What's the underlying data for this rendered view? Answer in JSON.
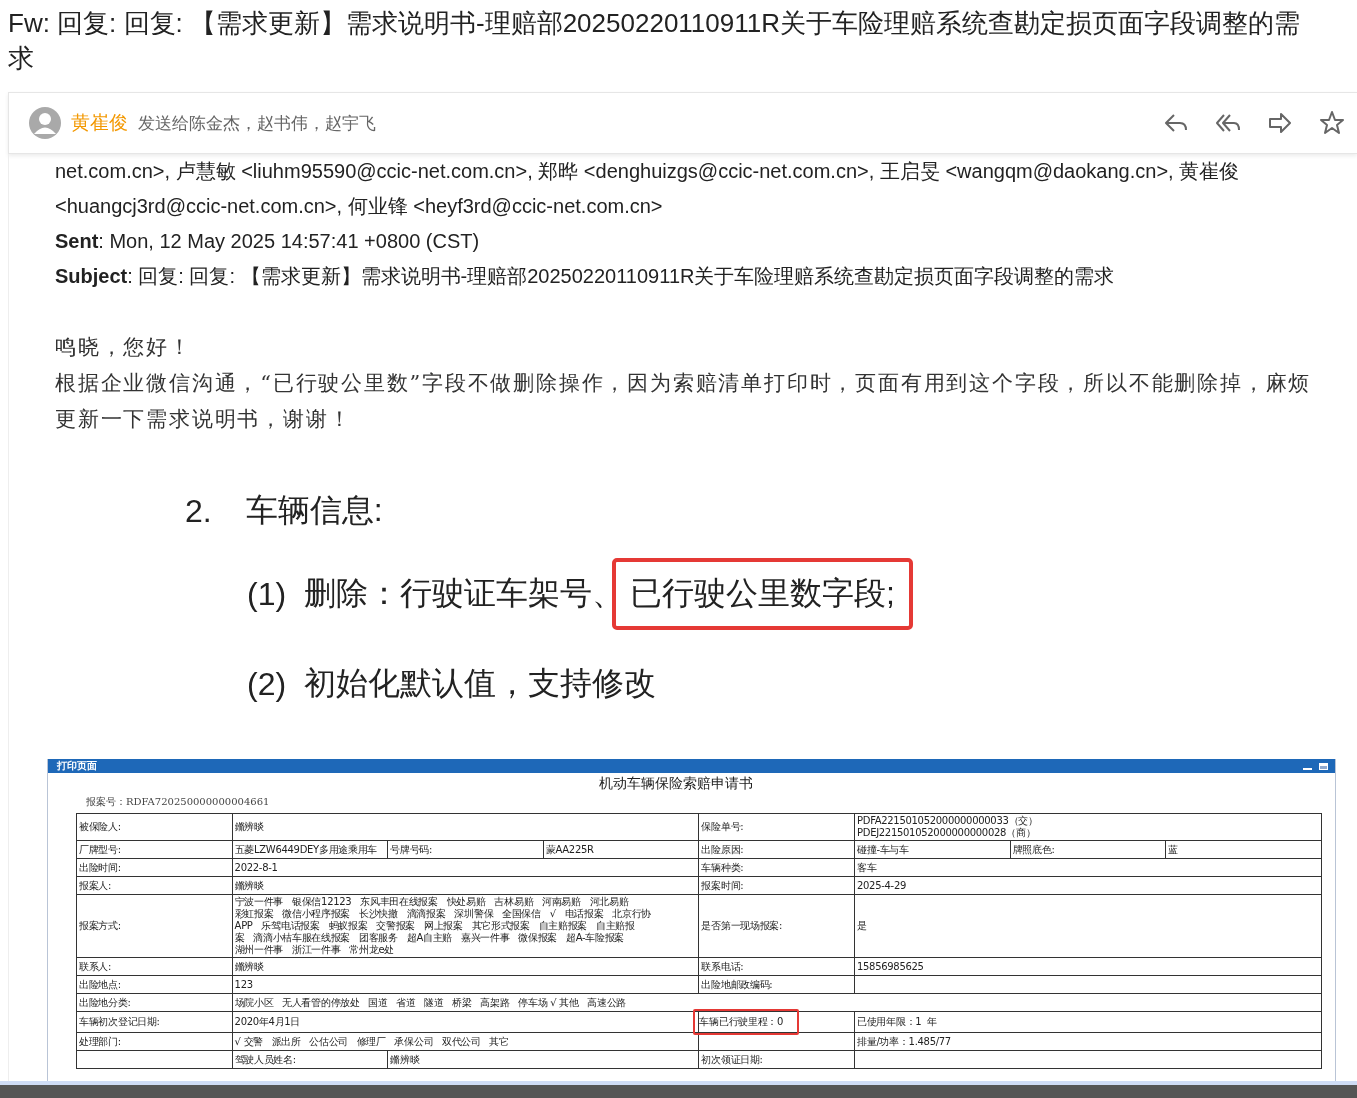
{
  "title": "Fw: 回复: 回复: 【需求更新】需求说明书-理赔部20250220110911R关于车险理赔系统查勘定损页面字段调整的需求",
  "sender": {
    "name": "黄崔俊",
    "recipients": "发送给陈金杰，赵书伟，赵宇飞"
  },
  "headers": [
    "net.com.cn>, 卢慧敏 <liuhm95590@ccic-net.com.cn>, 郑晔 <denghuizgs@ccic-net.com.cn>, 王启旻 <wangqm@daokang.cn>, 黄崔俊",
    "<huangcj3rd@ccic-net.com.cn>, 何业锋 <heyf3rd@ccic-net.com.cn>",
    "**Sent**: Mon, 12 May 2025 14:57:41 +0800 (CST)",
    "**Subject**: 回复: 回复: 【需求更新】需求说明书-理赔部20250220110911R关于车险理赔系统查勘定损页面字段调整的需求"
  ],
  "body": [
    "鸣晓，您好！",
    "根据企业微信沟通，“已行驶公里数”字段不做删除操作，因为索赔清单打印时，页面有用到这个字段，所以不能删除掉，麻烦更新一下需求说明书，谢谢！"
  ],
  "spec": {
    "number": "2.",
    "heading": "车辆信息:",
    "items": [
      {
        "number": "(1)",
        "text": "删除：行驶证车架号、",
        "highlight_text": "已行驶公里数字段;"
      },
      {
        "number": "(2)",
        "text": "初始化默认值，支持修改"
      }
    ]
  },
  "print_page": {
    "window_title": "打印页面",
    "doc_title": "机动车辆保险索赔申请书",
    "report_no": "报案号：RDFA720250000000004661",
    "rows": [
      [
        {
          "text": "被保险人:",
          "highlighted": false
        },
        {
          "text": "鏅辨晱",
          "colspan": 3,
          "highlighted": false
        },
        {
          "text": "保险单号:",
          "highlighted": false
        },
        {
          "lines": [
            "PDFA221501052000000000033（交）",
            "PDEJ221501052000000000028（商）"
          ],
          "colspan": 3,
          "highlighted": false
        }
      ],
      [
        {
          "text": "厂牌型号:",
          "highlighted": false
        },
        {
          "text": "五菱LZW6449DEY多用途乘用车",
          "highlighted": false
        },
        {
          "text": "号牌号码:",
          "highlighted": false
        },
        {
          "text": "蒙AA225R",
          "highlighted": false
        },
        {
          "text": "出险原因:",
          "highlighted": false
        },
        {
          "text": "碰撞-车与车",
          "highlighted": false
        },
        {
          "text": "牌照底色:",
          "highlighted": false
        },
        {
          "text": "蓝",
          "highlighted": false
        }
      ],
      [
        {
          "text": "出险时间:",
          "highlighted": false
        },
        {
          "text": "2022-8-1",
          "colspan": 3,
          "highlighted": false
        },
        {
          "text": "车辆种类:",
          "highlighted": false
        },
        {
          "text": "客车",
          "colspan": 3,
          "highlighted": false
        }
      ],
      [
        {
          "text": "报案人:",
          "highlighted": false
        },
        {
          "text": "鏅辨晱",
          "colspan": 3,
          "highlighted": false
        },
        {
          "text": "报案时间:",
          "highlighted": false
        },
        {
          "text": "2025-4-29",
          "colspan": 3,
          "highlighted": false
        }
      ],
      [
        {
          "text": "报案方式:",
          "highlighted": false
        },
        {
          "lines": [
            "宁波一件事   银保信12123   东风丰田在线报案   快处易赔   吉林易赔   河南易赔   河北易赔",
            "彩虹报案   微信小程序报案   长沙快撤   滴滴报案   深圳警保   全国保信 √ 电话报案   北京行协",
            "APP   乐驾电话报案   蚂蚁报案   交警报案   网上报案   其它形式报案   自主赔报案   自主赔报",
            "案   滴滴小桔车服在线报案   团客服务   超A自主赔   嘉兴一件事   微保报案   超A-车险报案",
            "湖州一件事   浙江一件事   常州龙e处"
          ],
          "colspan": 3,
          "highlighted": false
        },
        {
          "text": "是否第一现场报案:",
          "highlighted": false
        },
        {
          "text": "是",
          "colspan": 3,
          "highlighted": false
        }
      ],
      [
        {
          "text": "联系人:",
          "highlighted": false
        },
        {
          "text": "鏅辨晱",
          "colspan": 3,
          "highlighted": false
        },
        {
          "text": "联系电话:",
          "highlighted": false
        },
        {
          "text": "15856985625",
          "colspan": 3,
          "highlighted": false
        }
      ],
      [
        {
          "text": "出险地点:",
          "highlighted": false
        },
        {
          "text": "123",
          "colspan": 3,
          "highlighted": false
        },
        {
          "text": "出险地邮政编码:",
          "highlighted": false
        },
        {
          "colspan": 3,
          "highlighted": false
        }
      ],
      [
        {
          "text": "出险地分类:",
          "highlighted": false
        },
        {
          "text": "场院小区   无人看管的停放处   国道   省道   隧道   桥梁   高架路   停车场 √ 其他   高速公路",
          "colspan": 7,
          "highlighted": false
        }
      ],
      [
        {
          "text": "车辆初次登记日期:",
          "highlighted": false
        },
        {
          "text": "2020年4月1日",
          "colspan": 3,
          "highlighted": false
        },
        {
          "text": "车辆已行驶里程：0",
          "highlighted": true
        },
        {
          "text": "已使用年限：1  年",
          "colspan": 3,
          "highlighted": false
        }
      ],
      [
        {
          "text": "处理部门:",
          "highlighted": false
        },
        {
          "text": "√ 交警   派出所   公估公司   修理厂   承保公司   双代公司   其它",
          "colspan": 3,
          "highlighted": false
        },
        {
          "highlighted": false
        },
        {
          "text": "排量/功率：1.485/77",
          "colspan": 3,
          "highlighted": false
        }
      ],
      [
        {
          "highlighted": false
        },
        {
          "text": "驾驶人员姓名:",
          "highlighted": false
        },
        {
          "text": "鏅辨晱",
          "colspan": 2,
          "highlighted": false
        },
        {
          "text": "初次领证日期:",
          "highlighted": false
        },
        {
          "colspan": 3,
          "highlighted": false
        }
      ]
    ]
  }
}
